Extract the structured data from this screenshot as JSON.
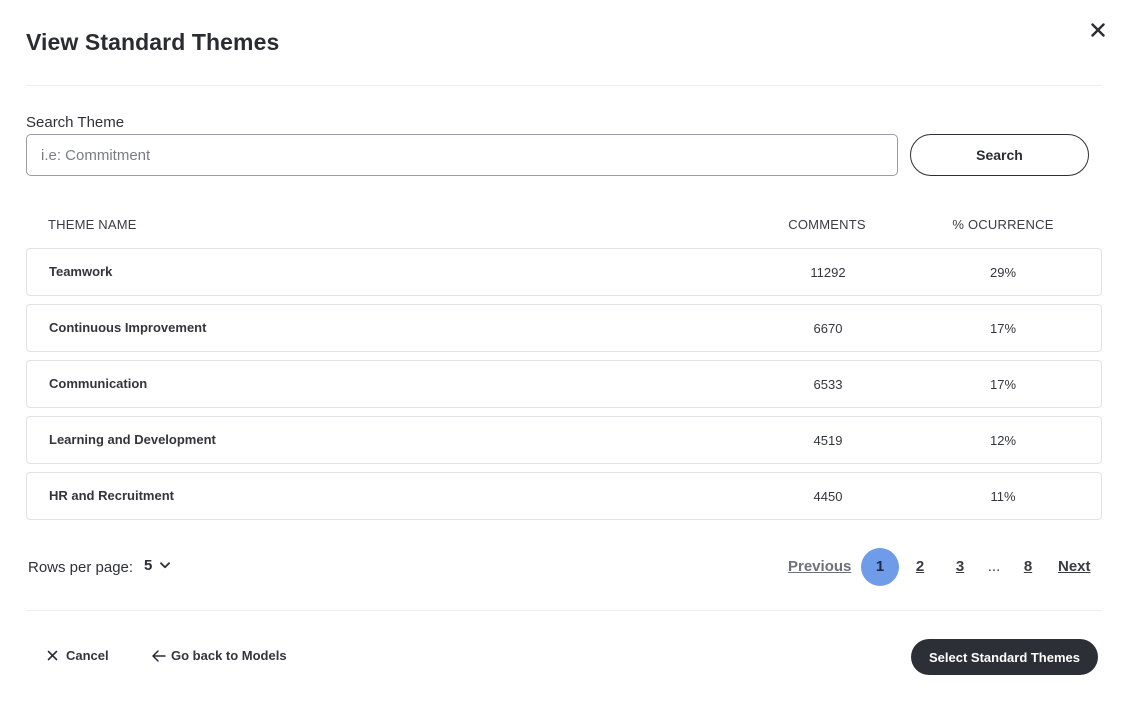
{
  "modal": {
    "title": "View Standard Themes"
  },
  "search": {
    "label": "Search Theme",
    "placeholder": "i.e: Commitment",
    "value": "",
    "button_label": "Search"
  },
  "table": {
    "headers": {
      "name": "THEME NAME",
      "comments": "COMMENTS",
      "occurrence": "% OCURRENCE"
    },
    "rows": [
      {
        "name": "Teamwork",
        "comments": "11292",
        "occurrence": "29%"
      },
      {
        "name": "Continuous Improvement",
        "comments": "6670",
        "occurrence": "17%"
      },
      {
        "name": "Communication",
        "comments": "6533",
        "occurrence": "17%"
      },
      {
        "name": "Learning and Development",
        "comments": "4519",
        "occurrence": "12%"
      },
      {
        "name": "HR and Recruitment",
        "comments": "4450",
        "occurrence": "11%"
      }
    ]
  },
  "pagination": {
    "rows_per_page_label": "Rows per page:",
    "rows_per_page_value": "5",
    "previous": "Previous",
    "pages": [
      "1",
      "2",
      "3",
      "8"
    ],
    "ellipsis": "...",
    "current_page": "1",
    "next": "Next"
  },
  "footer": {
    "cancel_label": "Cancel",
    "back_label": "Go back to Models",
    "primary_label": "Select Standard Themes"
  },
  "colors": {
    "accent": "#6e9ce8",
    "primary_button": "#2c2f36"
  }
}
